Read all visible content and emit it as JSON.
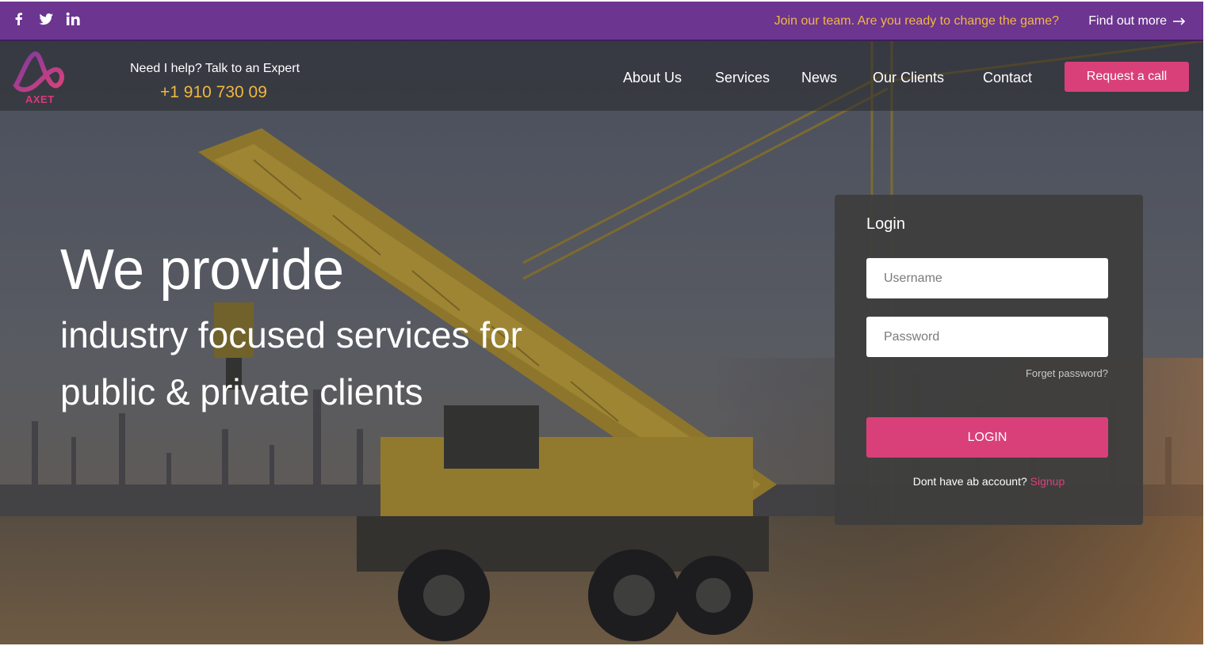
{
  "topbar": {
    "social": [
      "facebook-icon",
      "twitter-icon",
      "linkedin-icon"
    ],
    "promo_text": "Join our team. Are you ready to change the game?",
    "find_out_more": "Find out more"
  },
  "header": {
    "logo_text": "AXET",
    "help_text": "Need I help? Talk to an Expert",
    "phone": "+1 910 730 09",
    "nav": [
      "About Us",
      "Services",
      "News",
      "Our Clients",
      "Contact"
    ],
    "request_call": "Request a call"
  },
  "hero": {
    "line1": "We provide",
    "line2": "industry focused services for",
    "line3": "public & private clients"
  },
  "login": {
    "title": "Login",
    "username_placeholder": "Username",
    "password_placeholder": "Password",
    "forgot": "Forget password?",
    "button": "LOGIN",
    "no_account": "Dont have ab account?",
    "signup": "Signup"
  },
  "colors": {
    "topbar": "#6c3590",
    "accent": "#d9407a",
    "gold": "#f0b83d"
  }
}
